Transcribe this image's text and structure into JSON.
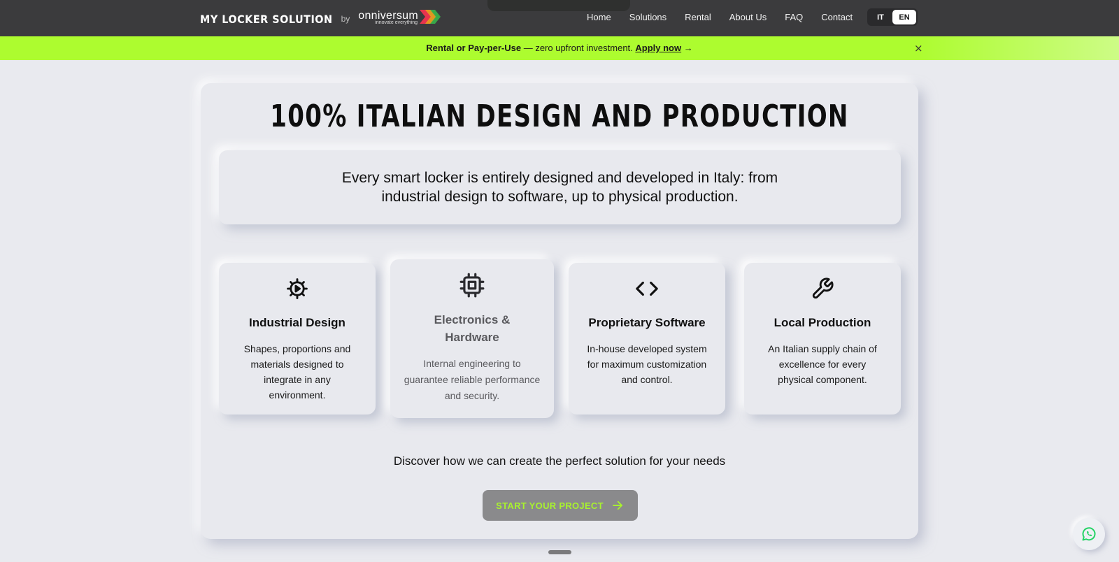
{
  "header": {
    "brand_name": "MY LOCKER SOLUTION",
    "brand_by": "by",
    "logo_word": "onniversum",
    "logo_tagline": "innovate everything",
    "nav": [
      "Home",
      "Solutions",
      "Rental",
      "About Us",
      "FAQ",
      "Contact"
    ],
    "lang": {
      "it": "IT",
      "en": "EN",
      "selected": "EN"
    }
  },
  "promo": {
    "bold": "Rental or Pay-per-Use",
    "text": " — zero upfront investment. ",
    "link": "Apply now",
    "arrow": "→",
    "close": "×"
  },
  "main": {
    "title": "100% ITALIAN DESIGN AND PRODUCTION",
    "intro": "Every smart locker is entirely designed and developed in Italy: from industrial design to software, up to physical production.",
    "features": [
      {
        "icon": "gear-play-icon",
        "title": "Industrial Design",
        "text": "Shapes, proportions and materials designed to integrate in any environment."
      },
      {
        "icon": "chip-icon",
        "title": "Electronics & Hardware",
        "text": "Internal engineering to guarantee reliable performance and security."
      },
      {
        "icon": "code-icon",
        "title": "Proprietary Software",
        "text": "In-house developed system for maximum customization and control."
      },
      {
        "icon": "wrench-icon",
        "title": "Local Production",
        "text": "An Italian supply chain of excellence for every physical component."
      }
    ],
    "discover": "Discover how we can create the perfect solution for your needs",
    "cta": "START YOUR PROJECT"
  },
  "colors": {
    "topbar": "#3b3b3d",
    "accent_green": "#adfc2f",
    "background": "#e9eaef",
    "cta_bg": "#8a8a8c",
    "whatsapp": "#25d366"
  }
}
